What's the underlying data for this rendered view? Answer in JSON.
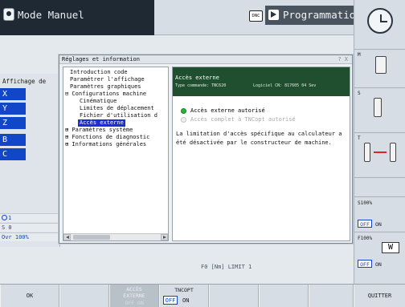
{
  "header": {
    "mode_label": "Mode Manuel",
    "dnc_label": "DNC",
    "programming_label": "Programmation"
  },
  "side": {
    "affichage": "Affichage de",
    "axes": [
      "X",
      "Y",
      "Z",
      "B",
      "C"
    ],
    "status": [
      {
        "icon": "spindle-icon",
        "text": "1"
      },
      {
        "icon": "",
        "text": "S 0"
      },
      {
        "icon": "",
        "text": "Ovr 100%"
      }
    ]
  },
  "right_col": {
    "m_label": "M",
    "s_label": "S",
    "t_label": "T",
    "s_feed": "S100%",
    "f_feed": "F100%",
    "off": "OFF",
    "on": "ON"
  },
  "dialog": {
    "title": "Réglages et information",
    "window_buttons": "? X",
    "tree": [
      "Introduction code",
      "Paramétrer l'affichage",
      "Paramètres graphiques",
      "⊟ Configurations machine",
      "Cinématique",
      "Limites de déplacement",
      "Fichier d'utilisation d",
      "Accès externe",
      "⊞ Paramètres système",
      "⊞ Fonctions de diagnostic",
      "⊞ Informations générales"
    ],
    "selected_index": 7,
    "content": {
      "title": "Accès externe",
      "type_label": "Type commande: TNC620",
      "software_label": "Logiciel CN: 817605 04 Sev",
      "option1": "Accès externe autorisé",
      "option2": "Accès complet à TNCopt autorisé",
      "info_line1": "La limitation d'accès spécifique au calculateur a",
      "info_line2": "été désactivée par le constructeur de machine."
    }
  },
  "underlay_text": "F0  [Nm]  LIMIT 1",
  "softkeys": {
    "ok": "OK",
    "acces_externe_l1": "ACCÈS",
    "acces_externe_l2": "EXTERNE",
    "acces_externe_l3": "OFF     ON",
    "tncopt": "TNCOPT",
    "tncopt_off": "OFF",
    "tncopt_on": "ON",
    "quitter": "QUITTER"
  }
}
